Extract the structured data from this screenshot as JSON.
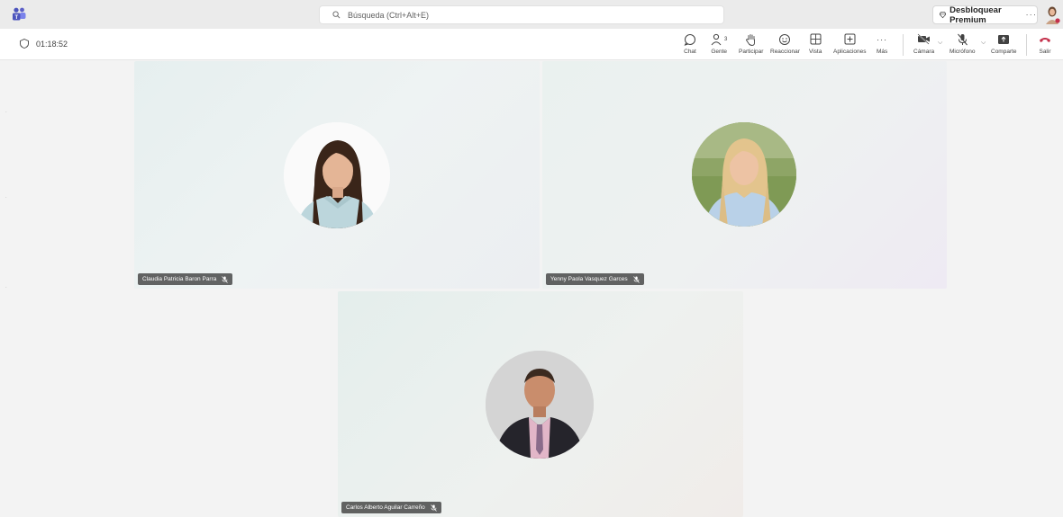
{
  "titlebar": {
    "search_placeholder": "Búsqueda (Ctrl+Alt+E)",
    "premium_label": "Desbloquear Premium",
    "premium_more": "···"
  },
  "toolbar": {
    "timer": "01:18:52",
    "chat": "Chat",
    "people": "Gente",
    "people_count": "3",
    "participate": "Participar",
    "react": "Reaccionar",
    "view": "Vista",
    "apps": "Aplicaciones",
    "more": "Más",
    "more_glyph": "···",
    "camera": "Cámara",
    "mic": "Micrófono",
    "share": "Comparte",
    "leave": "Salir"
  },
  "participants": [
    {
      "name": "Claudia Patricia Baron Parra"
    },
    {
      "name": "Yenny Paola Vasquez Garces"
    },
    {
      "name": "Carlos Alberto Aguilar Carreño"
    }
  ],
  "colors": {
    "accent": "#5b5fc7",
    "leave": "#c4314b",
    "tag_bg": "#3a3a3a"
  }
}
